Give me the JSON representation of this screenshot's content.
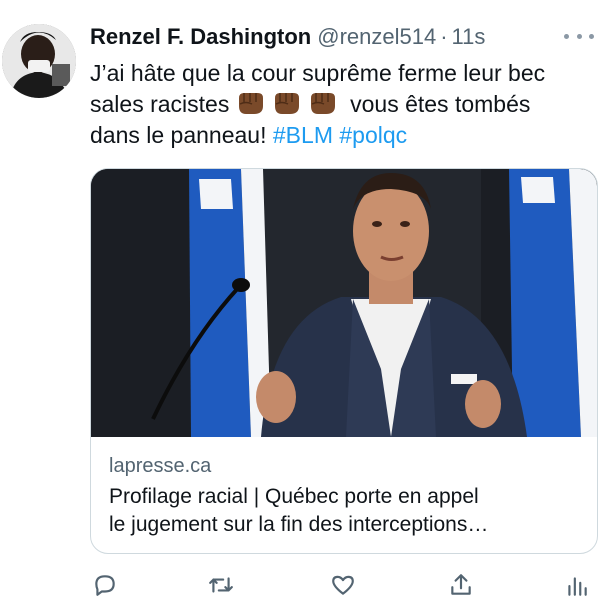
{
  "tweet": {
    "display_name": "Renzel F. Dashington",
    "handle": "@renzel514",
    "separator": "·",
    "time": "11s",
    "text_line1": "J’ai hâte que la cour suprême ferme leur bec",
    "text_line2_start": "sales racistes",
    "text_line2_end": "vous êtes tombés",
    "text_line3_start": "dans le panneau!",
    "hashtags": [
      "#BLM",
      "#polqc"
    ],
    "emoji_icon": "raised-fist-medium-dark-skin-tone",
    "emoji_count": 3
  },
  "card": {
    "domain": "lapresse.ca",
    "title_line1": "Profilage racial | Québec porte en appel",
    "title_line2": "le jugement sur la fin des interceptions…"
  },
  "actions": {
    "icons": [
      "reply-icon",
      "retweet-icon",
      "like-icon",
      "share-icon",
      "analytics-icon"
    ]
  },
  "colors": {
    "accent": "#1d9bf0",
    "muted": "#536471",
    "text": "#0f1419",
    "border": "#cfd9de",
    "flag_blue": "#1f5bbf"
  }
}
